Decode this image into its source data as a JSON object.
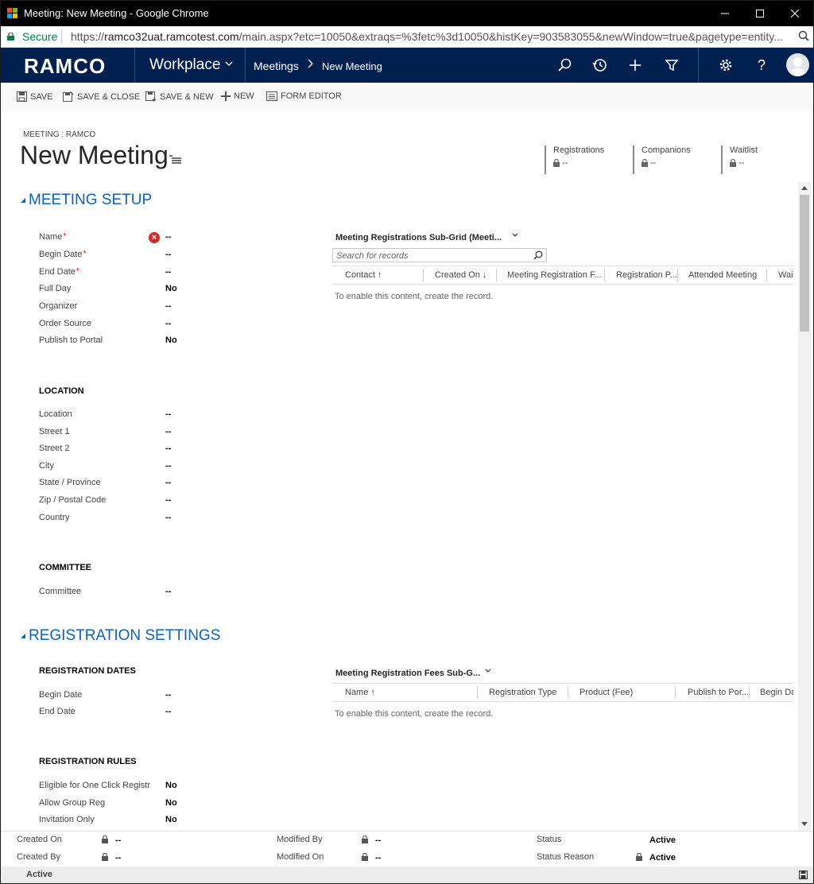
{
  "browser": {
    "window_title": "Meeting: New Meeting - Google Chrome",
    "secure_label": "Secure",
    "url_scheme": "https://",
    "url_host": "ramco32uat.ramcotest.com",
    "url_rest": "/main.aspx?etc=10050&extraqs=%3fetc%3d10050&histKey=903583055&newWindow=true&pagetype=entity..."
  },
  "nav": {
    "brand": "RAMCO",
    "workplace": "Workplace",
    "breadcrumb_1": "Meetings",
    "breadcrumb_2": "New Meeting"
  },
  "commands": {
    "save": "SAVE",
    "save_close": "SAVE & CLOSE",
    "save_new": "SAVE & NEW",
    "new": "NEW",
    "form_editor": "FORM EDITOR"
  },
  "header": {
    "entity_type": "MEETING : RAMCO",
    "title": "New Meeting",
    "fields": [
      {
        "label": "Registrations",
        "value": "--"
      },
      {
        "label": "Companions",
        "value": "--"
      },
      {
        "label": "Waitlist",
        "value": "--"
      }
    ]
  },
  "meeting_setup": {
    "title": "MEETING SETUP",
    "fields": [
      {
        "label": "Name",
        "value": "--"
      },
      {
        "label": "Begin Date",
        "value": "--"
      },
      {
        "label": "End Date",
        "value": "--"
      },
      {
        "label": "Full Day",
        "value": "No"
      },
      {
        "label": "Organizer",
        "value": "--"
      },
      {
        "label": "Order Source",
        "value": "--"
      },
      {
        "label": "Publish to Portal",
        "value": "No"
      }
    ],
    "location_title": "LOCATION",
    "location_fields": [
      {
        "label": "Location",
        "value": "--"
      },
      {
        "label": "Street 1",
        "value": "--"
      },
      {
        "label": "Street 2",
        "value": "--"
      },
      {
        "label": "City",
        "value": "--"
      },
      {
        "label": "State / Province",
        "value": "--"
      },
      {
        "label": "Zip / Postal Code",
        "value": "--"
      },
      {
        "label": "Country",
        "value": "--"
      }
    ],
    "committee_title": "COMMITTEE",
    "committee_fields": [
      {
        "label": "Committee",
        "value": "--"
      }
    ]
  },
  "registrations_grid": {
    "title": "Meeting Registrations Sub-Grid (Meeti...",
    "search_placeholder": "Search for records",
    "columns": [
      "Contact",
      "Created On",
      "Meeting Registration F...",
      "Registration P...",
      "Attended Meeting",
      "Wai"
    ],
    "empty_text": "To enable this content, create the record."
  },
  "registration_settings": {
    "title": "REGISTRATION SETTINGS",
    "dates_title": "REGISTRATION DATES",
    "dates_fields": [
      {
        "label": "Begin Date",
        "value": "--"
      },
      {
        "label": "End Date",
        "value": "--"
      }
    ],
    "rules_title": "REGISTRATION RULES",
    "rules_fields": [
      {
        "label": "Eligible for One Click Registr",
        "value": "No"
      },
      {
        "label": "Allow Group Reg",
        "value": "No"
      },
      {
        "label": "Invitation Only",
        "value": "No"
      }
    ]
  },
  "fees_grid": {
    "title": "Meeting Registration Fees Sub-G...",
    "columns": [
      "Name",
      "Registration Type",
      "Product (Fee)",
      "Publish to Por...",
      "Begin Da"
    ],
    "empty_text": "To enable this content, create the record."
  },
  "footer": {
    "created_on_label": "Created On",
    "created_on_value": "--",
    "created_by_label": "Created By",
    "created_by_value": "--",
    "modified_by_label": "Modified By",
    "modified_by_value": "--",
    "modified_on_label": "Modified On",
    "modified_on_value": "--",
    "status_label": "Status",
    "status_value": "Active",
    "status_reason_label": "Status Reason",
    "status_reason_value": "Active",
    "statusbar_text": "Active"
  },
  "colors": {
    "nav_bg": "#002050",
    "section_blue": "#1160b7",
    "required_red": "#e00000"
  }
}
